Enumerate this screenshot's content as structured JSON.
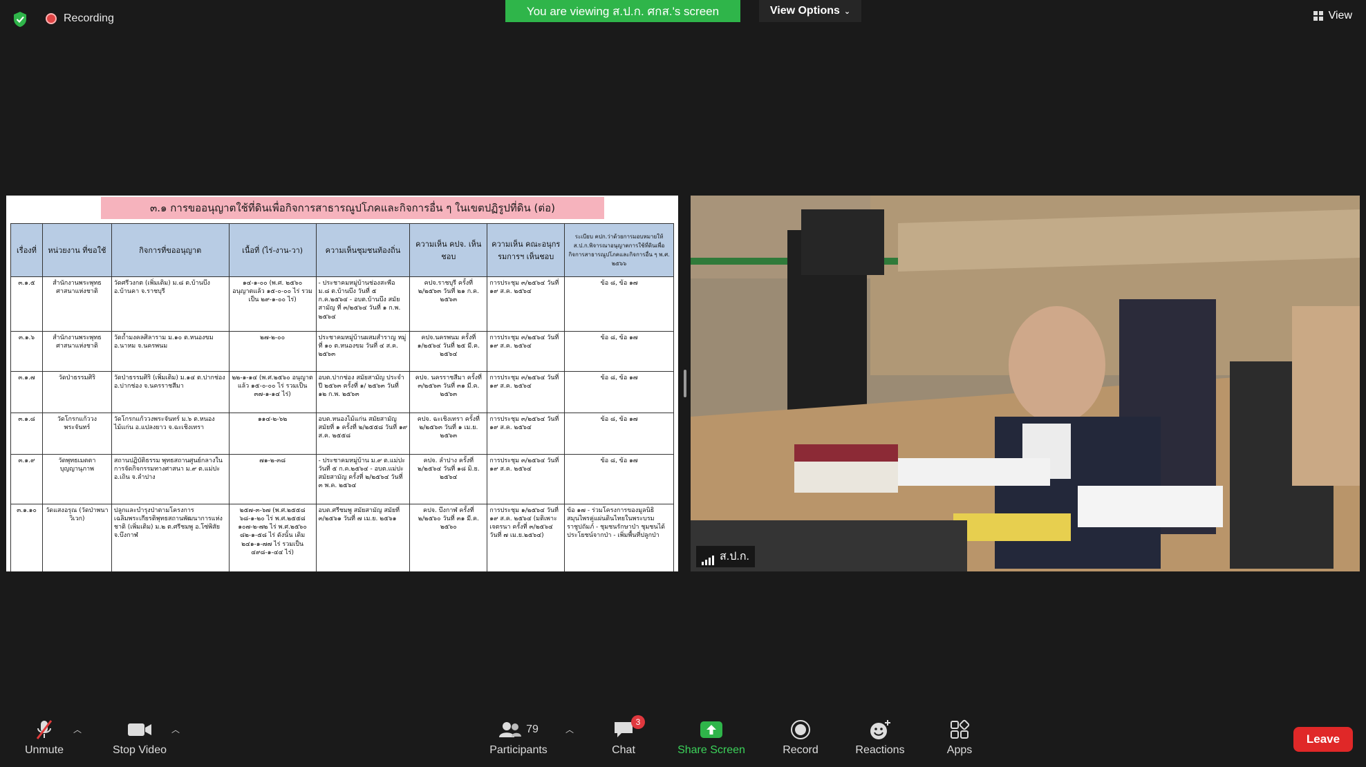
{
  "topbar": {
    "recording_label": "Recording",
    "viewing_banner": "You are viewing ส.ป.ก. ศกส.'s screen",
    "view_options_label": "View Options",
    "view_label": "View"
  },
  "shared_screen": {
    "title": "๓.๑ การขออนุญาตใช้ที่ดินเพื่อกิจการสาธารณูปโภคและกิจการอื่น ๆ ในเขตปฏิรูปที่ดิน (ต่อ)",
    "headers": [
      "เรื่องที่",
      "หน่วยงาน ที่ขอใช้",
      "กิจการที่ขออนุญาต",
      "เนื้อที่ (ไร่-งาน-วา)",
      "ความเห็นชุมชนท้องถิ่น",
      "ความเห็น คปจ. เห็นชอบ",
      "ความเห็น คณะอนุกรรมการฯ เห็นชอบ",
      "ระเบียบ คปก.ว่าด้วยการมอบหมายให้ ส.ป.ก.พิจารณาอนุญาตการใช้ที่ดินเพื่อกิจการสาธารณูปโภคและกิจการอื่น ๆ พ.ศ. ๒๕๖๖"
    ],
    "rows": [
      [
        "๓.๑.๕",
        "สำนักงานพระพุทธศาสนาแห่งชาติ",
        "วัดศรีวงกต (เพิ่มเติม) ม.๘ ต.บ้านบึง อ.บ้านคา จ.ราชบุรี",
        "๑๔-๑-๐๐ (พ.ศ. ๒๕๖๐ อนุญาตแล้ว ๑๕-๐-๐๐ ไร่ รวมเป็น ๒๙-๑-๐๐ ไร่)",
        "- ประชาคมหมู่บ้านช่องสะพือ ม.๘ ต.บ้านบึง วันที่ ๕ ก.ค.๒๕๖๔ - อบต.บ้านบึง สมัยสามัญ ที่ ๓/๒๕๖๔ วันที่ ๑ ก.พ. ๒๕๖๔",
        "คปจ.ราชบุรี ครั้งที่ ๒/๒๕๖๓ วันที่ ๒๑ ก.ค. ๒๕๖๓",
        "การประชุม ๓/๒๕๖๔ วันที่ ๑๙ ส.ค. ๒๕๖๔",
        "ข้อ ๘, ข้อ ๑๗"
      ],
      [
        "๓.๑.๖",
        "สำนักงานพระพุทธศาสนาแห่งชาติ",
        "วัดถ้ำมงคลศิลาราม ม.๑๐ ต.หนองขม อ.นาหม จ.นครพนม",
        "๒๗-๒-๐๐",
        "ประชาคมหมู่บ้านผสมสำราญ หมู่ที่ ๑๐ ต.หนองขม วันที่ ๔ ส.ค. ๒๕๖๓",
        "คปจ.นครพนม ครั้งที่ ๑/๒๕๖๔ วันที่ ๒๕ มี.ค. ๒๕๖๔",
        "การประชุม ๓/๒๕๖๔ วันที่ ๑๙ ส.ค. ๒๕๖๔",
        "ข้อ ๘, ข้อ ๑๗"
      ],
      [
        "๓.๑.๗",
        "วัดป่าธรรมศิริ",
        "วัดป่าธรรมศิริ (เพิ่มเติม) ม.๑๔ ต.ปากช่อง อ.ปากช่อง จ.นครราชสีมา",
        "๒๒-๑-๑๔ (พ.ศ.๒๕๖๐ อนุญาตแล้ว ๑๕-๐-๐๐ ไร่ รวมเป็น ๓๗-๑-๑๔ ไร่)",
        "อบต.ปากช่อง สมัยสามัญ ประจำปี ๒๕๖๓ ครั้งที่ ๑/ ๒๕๖๓ วันที่ ๑๒ ก.พ. ๒๕๖๓",
        "คปจ. นครราชสีมา ครั้งที่ ๓/๒๕๖๓ วันที่ ๓๑ มี.ค. ๒๕๖๓",
        "การประชุม ๓/๒๕๖๔ วันที่ ๑๙ ส.ค. ๒๕๖๔",
        "ข้อ ๘, ข้อ ๑๗"
      ],
      [
        "๓.๑.๘",
        "วัดโกรกแก้ววงพระจันทร์",
        "วัดโกรกแก้ววงพระจันทร์ ม.๖ ต.หนองไม้แก่น อ.แปลงยาว จ.ฉะเชิงเทรา",
        "๑๑๔-๒-๖๒",
        "อบต.หนองไม้แก่น สมัยสามัญ สมัยที่ ๑ ครั้งที่ ๒/๒๕๕๘ วันที่ ๑๙ ส.ค. ๒๕๕๘",
        "คปจ. ฉะเชิงเทรา ครั้งที่ ๒/๒๕๖๓ วันที่ ๑ เม.ย. ๒๕๖๓",
        "การประชุม ๓/๒๕๖๔ วันที่ ๑๙ ส.ค. ๒๕๖๔",
        "ข้อ ๘, ข้อ ๑๗"
      ],
      [
        "๓.๑.๙",
        "วัดพุทธเมตตาบุญญานุภาพ",
        "สถานปฏิบัติธรรม พุทธสถานศูนย์กลางในการจัดกิจกรรมทางศาสนา ม.๙ ต.แม่ปะ อ.เถิน จ.ลำปาง",
        "๗๑-๒-๓๘",
        "- ประชาคมหมู่บ้าน ม.๙ ต.แม่ปะ วันที่ ๕ ก.ค.๒๕๖๔ - อบต.แม่ปะ สมัยสามัญ ครั้งที่ ๒/๒๕๖๔ วันที่ ๓ พ.ค. ๒๕๖๔",
        "คปจ. ลำปาง ครั้งที่ ๒/๒๕๖๔ วันที่ ๑๘ มิ.ย. ๒๕๖๔",
        "การประชุม ๓/๒๕๖๔ วันที่ ๑๙ ส.ค. ๒๕๖๔",
        "ข้อ ๘, ข้อ ๑๗"
      ],
      [
        "๓.๑.๑๐",
        "วัดแสงอรุณ (วัดป่าพนาวิเวก)",
        "ปลูกและบำรุงป่าตามโครงการเฉลิมพระเกียรติพุทธสถานพัฒนาการแห่งชาติ (เพิ่มเติม) ม.๒ ต.ศรีชมพู อ.โซ่พิสัย จ.บึงกาฬ",
        "๒๕๗-๓-๖๗ (พ.ศ.๒๕๕๘ ๖๘-๑-๒๐ ไร่ พ.ศ.๒๕๕๘ ๑๐๗-๒-๗๒ ไร่ พ.ศ.๒๕๖๐ ๘๒-๑-๕๘ ไร่ ดังนั้น เดิม ๒๔๑-๑-๗๗ ไร่ รวมเป็น ๔๙๘-๑-๔๔ ไร่)",
        "อบต.ศรีชมพู สมัยสามัญ สมัยที่ ๓/๒๕๖๑ วันที่ ๗ เม.ย. ๒๕๖๑",
        "คปจ. บึงกาฬ ครั้งที่ ๒/๒๕๖๐ วันที่ ๓๑ มี.ค. ๒๕๖๐",
        "การประชุม ๑/๒๕๖๔ วันที่ ๑๙ ส.ค. ๒๕๖๔ (มติเพาะเจตรนา ครั้งที่ ๓/๒๕๖๔ วันที่ ๗ เม.ย.๒๕๖๔)",
        "ข้อ ๑๗ - ร่วมโครงการของมูลนิธิสมุนไพรคู่แผ่นดินไทยในพระบรมราชูปถัมภ์ - ชุมชนรักษาป่า ชุมชนได้ประโยชน์จากป่า - เพิ่มพื้นที่ปลูกป่า"
      ]
    ]
  },
  "video": {
    "participant_name": "ส.ป.ก."
  },
  "toolbar": {
    "unmute_label": "Unmute",
    "stop_video_label": "Stop Video",
    "participants_label": "Participants",
    "participants_count": "79",
    "chat_label": "Chat",
    "chat_badge": "3",
    "share_screen_label": "Share Screen",
    "record_label": "Record",
    "reactions_label": "Reactions",
    "apps_label": "Apps",
    "leave_label": "Leave"
  },
  "colors": {
    "banner_green": "#2fb54a",
    "leave_red": "#e02828",
    "share_green": "#2fb54a",
    "title_pink": "#f6b3bd",
    "table_header": "#b8cce4"
  },
  "icons": [
    "shield-icon",
    "recording-dot-icon",
    "chevron-down-icon",
    "grid-view-icon",
    "signal-bars-icon",
    "muted-mic-icon",
    "video-camera-icon",
    "participants-icon",
    "chat-icon",
    "share-screen-icon",
    "record-icon",
    "reactions-icon",
    "apps-icon"
  ]
}
